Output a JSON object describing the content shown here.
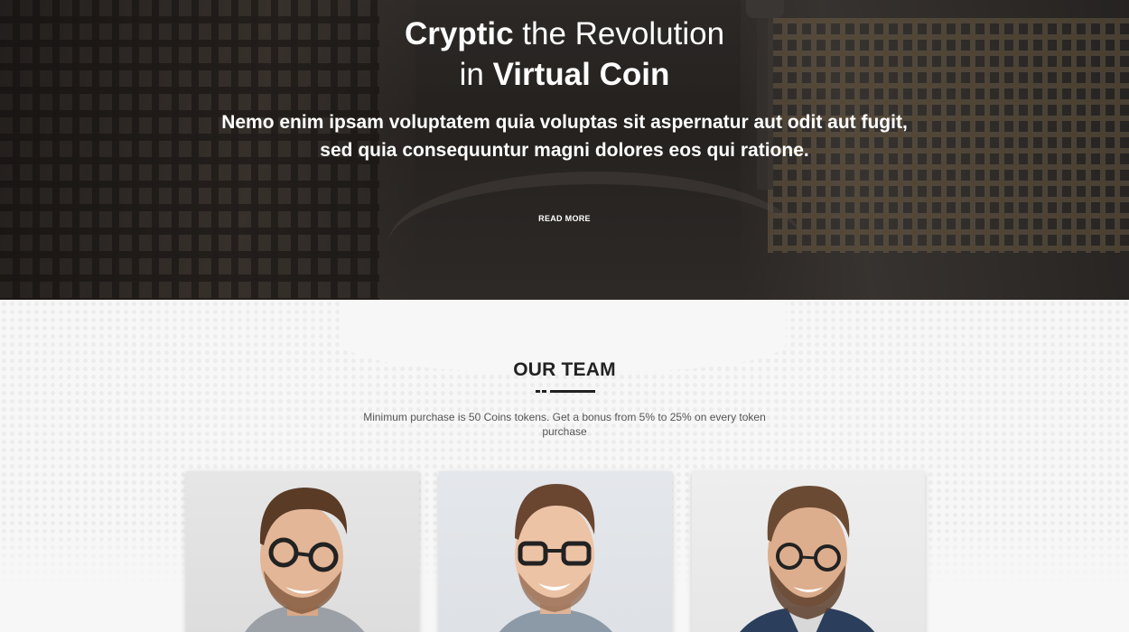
{
  "hero": {
    "title_line1_bold": "Cryptic",
    "title_line1_rest": " the Revolution",
    "title_line2_pre": "in ",
    "title_line2_bold": "Virtual Coin",
    "subtitle": "Nemo enim ipsam voluptatem quia voluptas sit aspernatur aut odit aut fugit, sed quia consequuntur magni dolores eos qui ratione.",
    "cta_label": "READ MORE"
  },
  "team": {
    "title": "OUR TEAM",
    "description": "Minimum purchase is 50 Coins tokens. Get a bonus from 5% to 25% on every token purchase",
    "members": [
      {
        "photo": "team-member-photo-1"
      },
      {
        "photo": "team-member-photo-2"
      },
      {
        "photo": "team-member-photo-3"
      }
    ]
  },
  "colors": {
    "title_text": "#222222",
    "body_text": "#555555",
    "hero_text": "#ffffff",
    "section_bg": "#f7f7f7"
  }
}
